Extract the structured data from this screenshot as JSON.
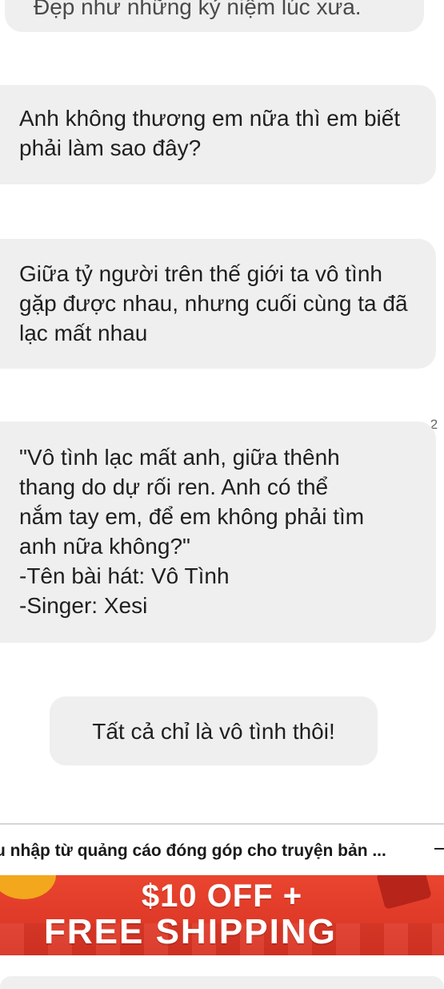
{
  "messages": {
    "partial_top": "Đẹp như những kỷ niệm lúc xưa.",
    "m1": "Anh không thương em nữa thì em biết phải làm sao đây?",
    "m2": "Giữa tỷ người trên thế giới ta vô tình gặp được nhau, nhưng cuối cùng ta đã lạc mất nhau",
    "m3_lines": [
      "\"Vô tình lạc mất anh, giữa thênh",
      "thang do dự rối ren. Anh có thể",
      "nắm tay em, để em không phải tìm",
      "anh nữa không?\"",
      "-Tên bài hát: Vô Tình",
      "-Singer: Xesi"
    ],
    "m4": "Tất cả chỉ là vô tình thôi!"
  },
  "comment_badge": "2",
  "ad": {
    "label": "u nhập từ quảng cáo đóng góp cho truyện bản ...",
    "banner_line1": "$10 OFF +",
    "banner_line2": "FREE SHIPPING"
  },
  "colors": {
    "bubble_bg": "#efefef",
    "banner_red": "#e03a28",
    "text": "#1f1f1f"
  }
}
